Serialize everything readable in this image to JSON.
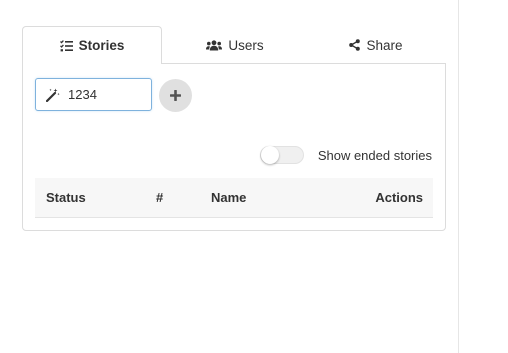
{
  "tabs": [
    {
      "label": "Stories",
      "icon": "list-check-icon",
      "active": true
    },
    {
      "label": "Users",
      "icon": "users-icon",
      "active": false
    },
    {
      "label": "Share",
      "icon": "share-icon",
      "active": false
    }
  ],
  "story_input": {
    "value": "1234",
    "icon": "magic-wand-icon"
  },
  "add_button": {
    "icon": "plus-icon"
  },
  "toggle": {
    "label": "Show ended stories",
    "checked": false
  },
  "table": {
    "columns": [
      "Status",
      "#",
      "Name",
      "Actions"
    ],
    "rows": []
  },
  "colors": {
    "input_focus_border": "#7fb2dd",
    "add_button_bg": "#e0e0e0",
    "header_bg": "#f7f7f7"
  }
}
